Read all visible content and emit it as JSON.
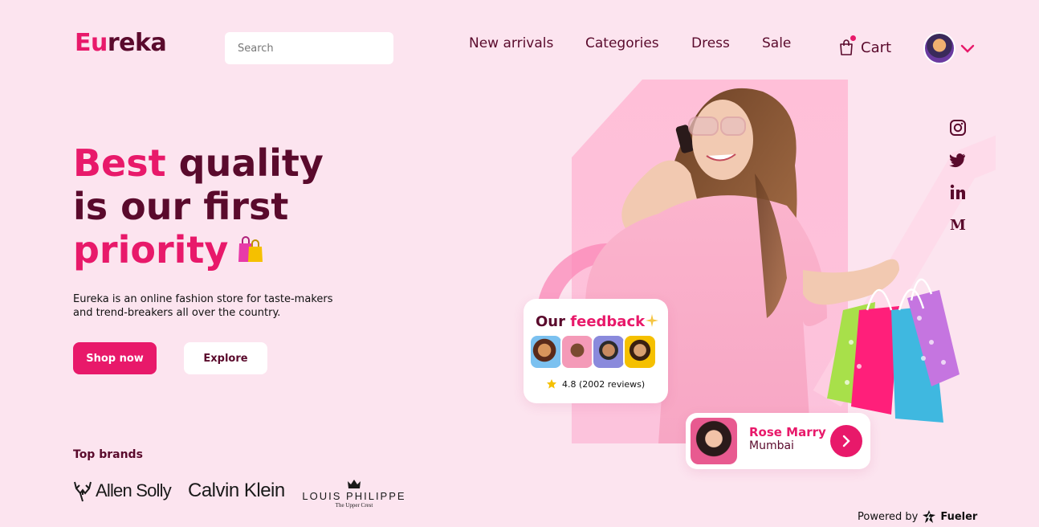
{
  "header": {
    "logo_accent": "Eu",
    "logo_rest": "reka",
    "search_placeholder": "Search",
    "nav": [
      "New arrivals",
      "Categories",
      "Dress",
      "Sale"
    ],
    "cart_label": "Cart"
  },
  "hero": {
    "title_1_pink": "Best",
    "title_1_rest": " quality",
    "title_2": "is our first",
    "title_3_pink": "priority",
    "description": "Eureka is an online fashion store for taste-makers and trend-breakers all over the country.",
    "shop_label": "Shop now",
    "explore_label": "Explore"
  },
  "brands": {
    "label": "Top brands",
    "items": [
      "Allen Solly",
      "Calvin Klein",
      "LOUIS PHILIPPE"
    ],
    "louis_tagline": "The Upper Crest"
  },
  "feedback": {
    "title_1": "Our",
    "title_2": "feedback",
    "rating": "4.8 (2002 reviews)"
  },
  "testimonial": {
    "name": "Rose Marry",
    "city": "Mumbai"
  },
  "footer": {
    "powered_prefix": "Powered by",
    "powered_brand": "Fueler"
  },
  "colors": {
    "accent": "#e8196a",
    "dark": "#5a0a2c",
    "background": "#fce4ef"
  },
  "icons": [
    "shopping-bag-icon",
    "chevron-down-icon",
    "instagram-icon",
    "twitter-icon",
    "linkedin-icon",
    "medium-icon",
    "star-icon",
    "arrow-right-icon",
    "sparkle-icon",
    "fueler-logo-icon"
  ]
}
